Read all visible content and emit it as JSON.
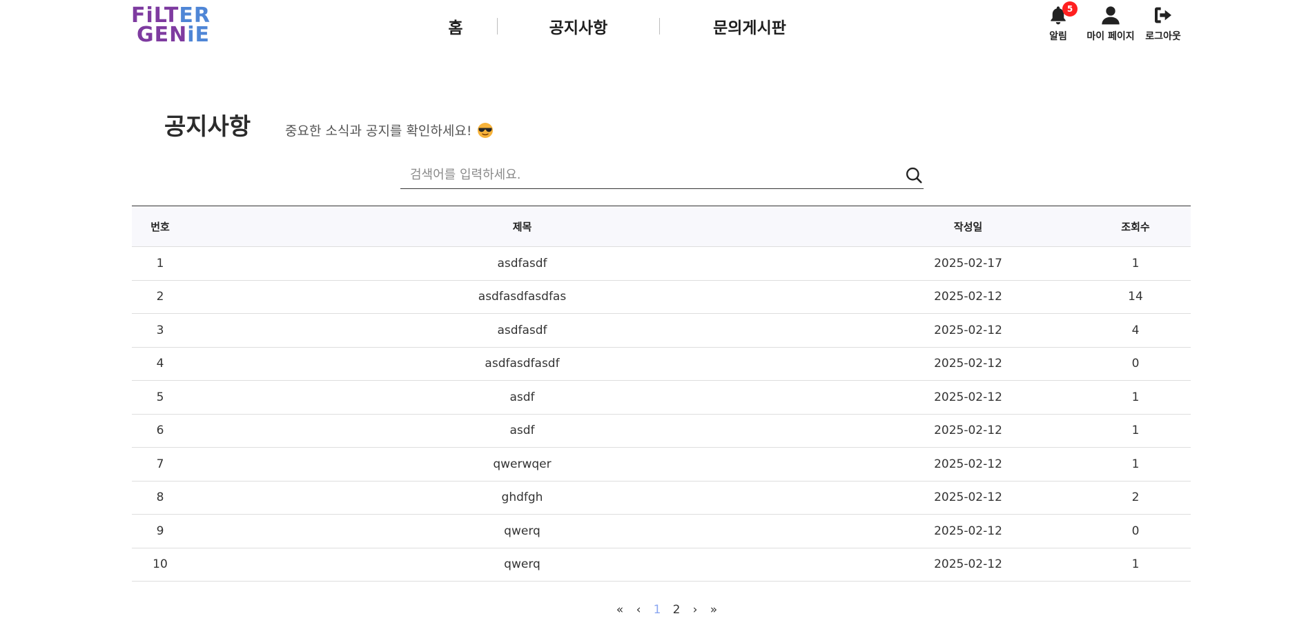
{
  "logo": {
    "line1_a": "FiLT",
    "line1_b": "ER",
    "line2_a": "GEN",
    "line2_b": "iE"
  },
  "nav": {
    "home": "홈",
    "notice": "공지사항",
    "inquiry": "문의게시판"
  },
  "user_actions": {
    "alarm_label": "알림",
    "alarm_count": "5",
    "mypage_label": "마이 페이지",
    "logout_label": "로그아웃"
  },
  "page": {
    "title": "공지사항",
    "subtitle": "중요한 소식과 공지를 확인하세요!"
  },
  "search": {
    "placeholder": "검색어를 입력하세요.",
    "value": ""
  },
  "table": {
    "headers": {
      "no": "번호",
      "title": "제목",
      "date": "작성일",
      "views": "조회수"
    },
    "rows": [
      {
        "no": "1",
        "title": "asdfasdf",
        "date": "2025-02-17",
        "views": "1"
      },
      {
        "no": "2",
        "title": "asdfasdfasdfas",
        "date": "2025-02-12",
        "views": "14"
      },
      {
        "no": "3",
        "title": "asdfasdf",
        "date": "2025-02-12",
        "views": "4"
      },
      {
        "no": "4",
        "title": "asdfasdfasdf",
        "date": "2025-02-12",
        "views": "0"
      },
      {
        "no": "5",
        "title": "asdf",
        "date": "2025-02-12",
        "views": "1"
      },
      {
        "no": "6",
        "title": "asdf",
        "date": "2025-02-12",
        "views": "1"
      },
      {
        "no": "7",
        "title": "qwerwqer",
        "date": "2025-02-12",
        "views": "1"
      },
      {
        "no": "8",
        "title": "ghdfgh",
        "date": "2025-02-12",
        "views": "2"
      },
      {
        "no": "9",
        "title": "qwerq",
        "date": "2025-02-12",
        "views": "0"
      },
      {
        "no": "10",
        "title": "qwerq",
        "date": "2025-02-12",
        "views": "1"
      }
    ]
  },
  "pagination": {
    "first": "«",
    "prev": "‹",
    "pages": [
      "1",
      "2"
    ],
    "current": "1",
    "next": "›",
    "last": "»"
  },
  "colors": {
    "accent_active_page": "#8aa6f0",
    "badge": "#ff1f1f",
    "logo_purple": "#7e3ba0",
    "logo_blue": "#4f86d6"
  },
  "icons": [
    "bell-icon",
    "user-icon",
    "logout-icon",
    "search-icon",
    "sunglasses-emoji-icon"
  ]
}
